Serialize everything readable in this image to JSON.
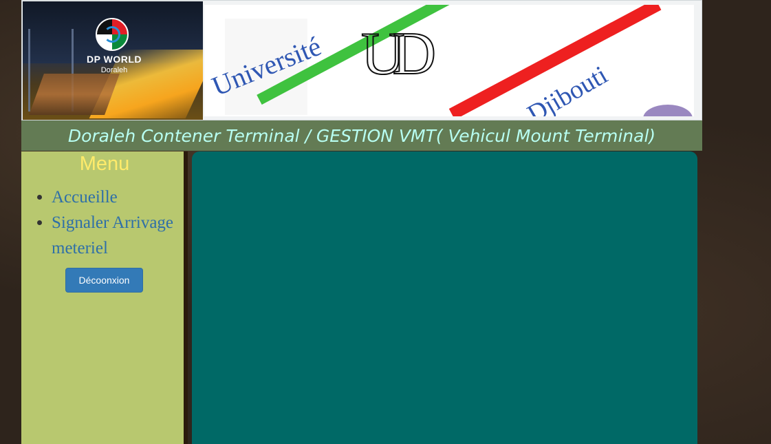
{
  "header": {
    "dp_logo": {
      "brand": "DP WORLD",
      "location": "Doraleh"
    },
    "univ_logo": {
      "monogram": "UD",
      "name_top": "Université",
      "name_bottom": "de Djibouti"
    },
    "title": "Doraleh Contener Terminal / GESTION VMT( Vehicul Mount Terminal)"
  },
  "sidebar": {
    "title": "Menu",
    "items": [
      {
        "label": "Accueille"
      },
      {
        "label": "Signaler Arrivage meteriel"
      }
    ],
    "logout_label": "Décoonxion"
  },
  "colors": {
    "title_bar_bg": "#637b54",
    "title_text": "#b8fff2",
    "sidebar_bg": "#b8c86f",
    "menu_title": "#ffeb6b",
    "link": "#2e6fa8",
    "button_bg": "#337ab7",
    "content_bg": "#006966"
  }
}
